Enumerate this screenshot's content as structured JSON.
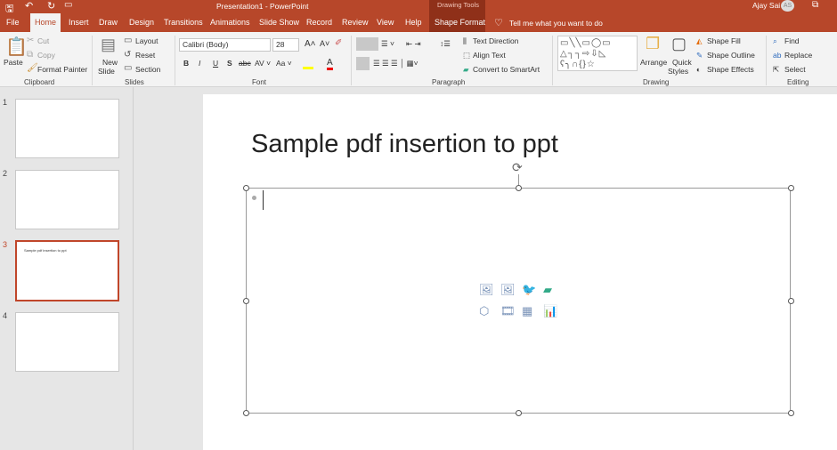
{
  "window": {
    "title": "Presentation1  -  PowerPoint",
    "context_group": "Drawing Tools",
    "user": "Ajay Sai",
    "initials": "AS"
  },
  "tabs": [
    "File",
    "Home",
    "Insert",
    "Draw",
    "Design",
    "Transitions",
    "Animations",
    "Slide Show",
    "Record",
    "Review",
    "View",
    "Help",
    "Shape Format"
  ],
  "tell_me": "Tell me what you want to do",
  "ribbon": {
    "clipboard": {
      "paste": "Paste",
      "cut": "Cut",
      "copy": "Copy",
      "format_painter": "Format Painter",
      "label": "Clipboard"
    },
    "slides": {
      "new_slide": "New",
      "new_slide2": "Slide",
      "layout": "Layout",
      "reset": "Reset",
      "section": "Section",
      "label": "Slides"
    },
    "font": {
      "name": "Calibri (Body)",
      "size": "28",
      "label": "Font"
    },
    "paragraph": {
      "text_direction": "Text Direction",
      "align_text": "Align Text",
      "smartart": "Convert to SmartArt",
      "label": "Paragraph"
    },
    "drawing": {
      "arrange": "Arrange",
      "quick": "Quick",
      "styles": "Styles",
      "fill": "Shape Fill",
      "outline": "Shape Outline",
      "effects": "Shape Effects",
      "label": "Drawing"
    },
    "editing": {
      "find": "Find",
      "replace": "Replace",
      "select": "Select",
      "label": "Editing"
    }
  },
  "slides_panel": [
    {
      "num": "1",
      "text": ""
    },
    {
      "num": "2",
      "text": ""
    },
    {
      "num": "3",
      "text": "Sample pdf insertion to ppt"
    },
    {
      "num": "4",
      "text": ""
    }
  ],
  "slide": {
    "title": "Sample pdf insertion to ppt"
  },
  "colors": {
    "accent": "#b7472a"
  }
}
